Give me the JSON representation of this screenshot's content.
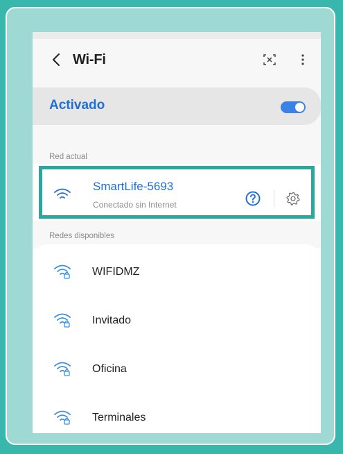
{
  "header": {
    "title": "Wi-Fi"
  },
  "toggle": {
    "label": "Activado",
    "enabled": true
  },
  "current": {
    "section_label": "Red actual",
    "name": "SmartLife-5693",
    "status": "Conectado sin Internet"
  },
  "available": {
    "section_label": "Redes disponibles",
    "networks": [
      {
        "name": "WIFIDMZ",
        "secured": true
      },
      {
        "name": "Invitado",
        "secured": true
      },
      {
        "name": "Oficina",
        "secured": true
      },
      {
        "name": "Terminales",
        "secured": true
      }
    ]
  },
  "colors": {
    "background": "#39b7ad",
    "frame": "#9ed9d3",
    "accent_blue": "#1e6fd8",
    "highlight_border": "#2aa8a0"
  },
  "icons": [
    "back-arrow-icon",
    "qr-scan-icon",
    "more-options-icon",
    "wifi-icon",
    "help-icon",
    "gear-icon",
    "wifi-lock-icon"
  ]
}
